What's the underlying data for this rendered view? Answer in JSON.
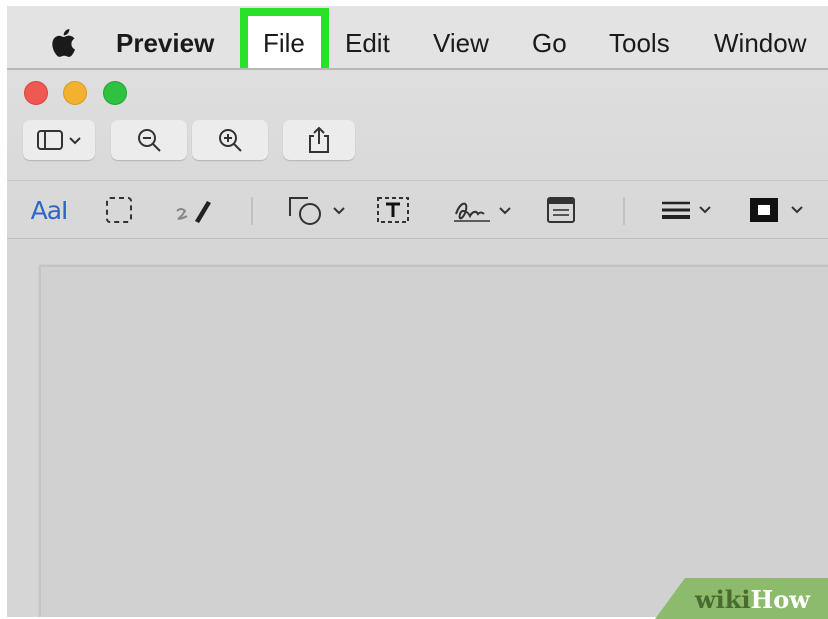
{
  "menubar": {
    "app_name": "Preview",
    "items": [
      {
        "label": "File",
        "highlighted": true
      },
      {
        "label": "Edit"
      },
      {
        "label": "View"
      },
      {
        "label": "Go"
      },
      {
        "label": "Tools"
      },
      {
        "label": "Window"
      }
    ]
  },
  "window": {
    "traffic_lights": [
      "close",
      "minimize",
      "zoom"
    ],
    "toolbar": [
      {
        "icon": "sidebar-icon",
        "dropdown": true
      },
      {
        "icon": "zoom-out-icon"
      },
      {
        "icon": "zoom-in-icon"
      },
      {
        "icon": "share-icon"
      }
    ],
    "markup_toolbar": {
      "text_tool_label": "AaI",
      "tools": [
        "text-selection-icon",
        "rectangular-selection-icon",
        "sketch-icon",
        "shapes-icon",
        "text-box-icon",
        "sign-icon",
        "note-icon",
        "line-style-icon",
        "border-color-icon"
      ]
    }
  },
  "watermark": {
    "part1": "wiki",
    "part2": "How"
  },
  "colors": {
    "highlight": "#29e128",
    "red": "#ee5a52",
    "yellow": "#f2b230",
    "green": "#2fc140",
    "accent_blue": "#2f65c8"
  }
}
